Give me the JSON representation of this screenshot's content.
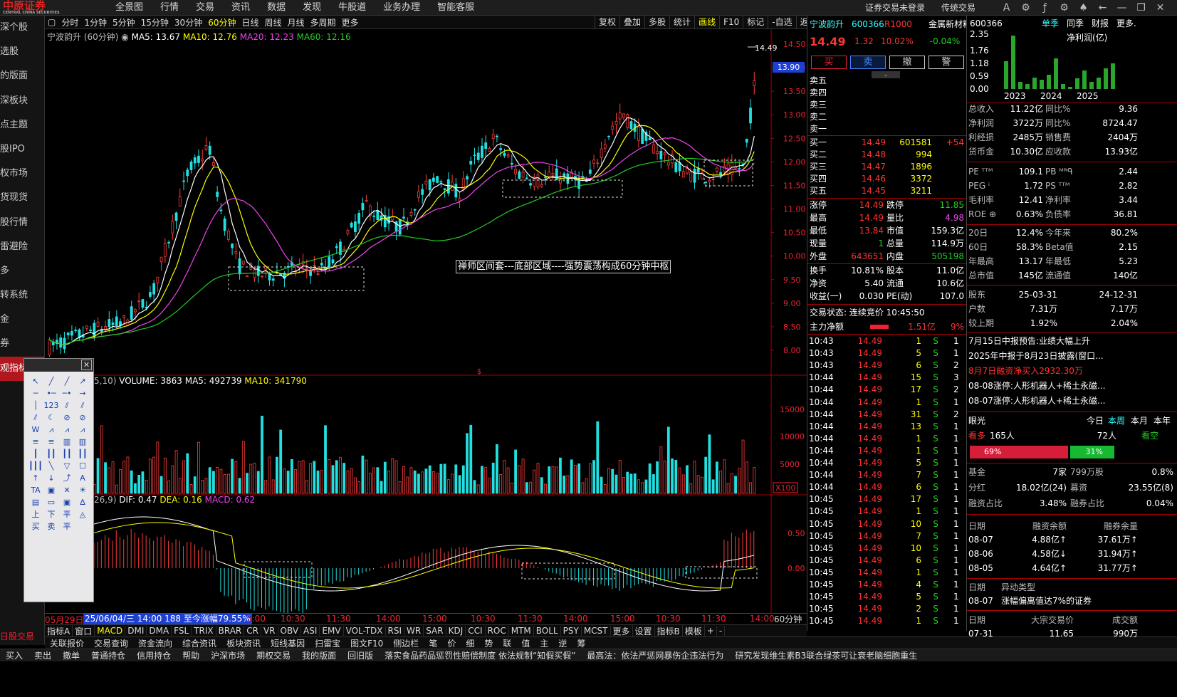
{
  "app": {
    "logo": "中原证券",
    "logo_en": "CENTRAL CHINA SECURITIES"
  },
  "menu": [
    "全景图",
    "行情",
    "交易",
    "资讯",
    "数据",
    "发现",
    "牛股道",
    "业务办理",
    "智能客服"
  ],
  "top_right": {
    "trade_status": "证券交易未登录",
    "traditional": "传统交易"
  },
  "left_nav": [
    "深个股",
    "选股",
    "的版面",
    "深板块",
    "点主题",
    "股IPO",
    "权市场",
    "货现货",
    "股行情",
    "雷避险",
    "多",
    "转系统",
    "金",
    "券",
    "观指标"
  ],
  "periods": [
    "分时",
    "1分钟",
    "5分钟",
    "15分钟",
    "30分钟",
    "60分钟",
    "日线",
    "周线",
    "月线",
    "多周期",
    "更多"
  ],
  "chart_buttons": [
    "复权",
    "叠加",
    "多股",
    "统计",
    "画线",
    "F10",
    "标记",
    "-自选",
    "返回"
  ],
  "ma_legend": {
    "name": "宁波韵升 (60分钟)",
    "ma5": "MA5: 13.67",
    "ma10": "MA10: 12.76",
    "ma20": "MA20: 12.23",
    "ma60": "MA60: 12.16"
  },
  "vol_legend": {
    "prefix": "5,10)",
    "vol": "VOLUME: 3863",
    "ma5": "MA5: 492739",
    "ma10": "MA10: 341790"
  },
  "macd_legend": {
    "prefix": "26,9)",
    "dif": "DIF: 0.47",
    "dea": "DEA: 0.16",
    "macd": "MACD: 0.62"
  },
  "annotation": "禅师区间套---底部区域----强势震荡构成60分钟中枢",
  "price_axis": [
    "14.50",
    "14.00",
    "13.50",
    "13.00",
    "12.50",
    "12.00",
    "11.50",
    "11.00",
    "10.50",
    "10.00",
    "9.50",
    "9.00",
    "8.50",
    "8.00"
  ],
  "current_price_tag": "13.90",
  "high_label": "14.49",
  "vol_axis": [
    "15000",
    "10000",
    "5000",
    "X100"
  ],
  "macd_axis": [
    "0.50",
    "0.00"
  ],
  "time_bar": {
    "start": "05月29日",
    "cursor": "25/06/04/三 14:00 188 至今涨幅79.55%",
    "ticks": [
      "5:00",
      "10:30",
      "11:30",
      "14:00",
      "15:00",
      "10:30",
      "11:30",
      "14:00",
      "15:00",
      "10:30",
      "11:30",
      "14:00"
    ],
    "period": "60分钟"
  },
  "indicators": [
    "指标A",
    "窗口",
    "MACD",
    "DMI",
    "DMA",
    "FSL",
    "TRIX",
    "BRAR",
    "CR",
    "VR",
    "OBV",
    "ASI",
    "EMV",
    "VOL-TDX",
    "RSI",
    "WR",
    "SAR",
    "KDJ",
    "CCI",
    "ROC",
    "MTM",
    "BOLL",
    "PSY",
    "MCST",
    "更多",
    "设置",
    "指标B",
    "模板",
    "+",
    "-"
  ],
  "bottom": [
    "关联报价",
    "交易查询",
    "资金流向",
    "综合资讯",
    "板块资讯",
    "短线基因",
    "扫雷宝",
    "图文F10",
    "侧边栏"
  ],
  "bottom_right_tabs": [
    "笔",
    "价",
    "细",
    "势",
    "联",
    "值",
    "主",
    "逆",
    "筹"
  ],
  "status": [
    "买入",
    "卖出",
    "撤单",
    "普通持仓",
    "信用持仓",
    "帮助",
    "沪深市场",
    "期权交易",
    "我的版面",
    "回旧版",
    "落实食品药品惩罚性赔偿制度 依法规制“知假买假”",
    "最高法：依法严惩网暴伤企违法行为",
    "研究发现维生素B3联合绿茶可让衰老脑细胞重生"
  ],
  "left_bottom_label": "日股交易",
  "quote": {
    "name": "宁波韵升",
    "code": "600366",
    "badge": "R1000",
    "sector": "金属新材料",
    "sector_chg": "-0.04%",
    "price": "14.49",
    "chg": "1.32",
    "pct": "10.02%",
    "buttons": [
      "买",
      "卖",
      "撤",
      "警"
    ],
    "sell": [
      {
        "l": "卖五"
      },
      {
        "l": "卖四"
      },
      {
        "l": "卖三"
      },
      {
        "l": "卖二"
      },
      {
        "l": "卖一"
      }
    ],
    "buy": [
      {
        "l": "买一",
        "p": "14.49",
        "v": "601581",
        "x": "+54"
      },
      {
        "l": "买二",
        "p": "14.48",
        "v": "994",
        "x": ""
      },
      {
        "l": "买三",
        "p": "14.47",
        "v": "1896",
        "x": ""
      },
      {
        "l": "买四",
        "p": "14.46",
        "v": "3372",
        "x": ""
      },
      {
        "l": "买五",
        "p": "14.45",
        "v": "3211",
        "x": ""
      }
    ],
    "stats": [
      [
        "涨停",
        "14.49",
        "跌停",
        "11.85"
      ],
      [
        "最高",
        "14.49",
        "量比",
        "4.98"
      ],
      [
        "最低",
        "13.84",
        "市值",
        "159.3亿"
      ],
      [
        "现量",
        "1",
        "总量",
        "114.9万"
      ],
      [
        "外盘",
        "643651",
        "内盘",
        "505198"
      ]
    ],
    "stats2": [
      [
        "换手",
        "10.81%",
        "股本",
        "11.0亿"
      ],
      [
        "净资",
        "5.40",
        "流通",
        "10.6亿"
      ],
      [
        "收益(一)",
        "0.030",
        "PE(动)",
        "107.0"
      ]
    ],
    "state": "交易状态: 连续竞价 10:45:50",
    "main_net": "主力净额",
    "main_net_val": "1.51亿",
    "main_net_pct": "9%",
    "ticks": [
      [
        "10:43",
        "14.49",
        "1",
        "S"
      ],
      [
        "10:43",
        "14.49",
        "5",
        "S"
      ],
      [
        "10:43",
        "14.49",
        "6",
        "S"
      ],
      [
        "10:44",
        "14.49",
        "15",
        "S"
      ],
      [
        "10:44",
        "14.49",
        "17",
        "S"
      ],
      [
        "10:44",
        "14.49",
        "1",
        "S"
      ],
      [
        "10:44",
        "14.49",
        "31",
        "S"
      ],
      [
        "10:44",
        "14.49",
        "13",
        "S"
      ],
      [
        "10:44",
        "14.49",
        "1",
        "S"
      ],
      [
        "10:44",
        "14.49",
        "1",
        "S"
      ],
      [
        "10:44",
        "14.49",
        "5",
        "S"
      ],
      [
        "10:44",
        "14.49",
        "7",
        "S"
      ],
      [
        "10:44",
        "14.49",
        "6",
        "S"
      ],
      [
        "10:45",
        "14.49",
        "17",
        "S"
      ],
      [
        "10:45",
        "14.49",
        "1",
        "S"
      ],
      [
        "10:45",
        "14.49",
        "10",
        "S"
      ],
      [
        "10:45",
        "14.49",
        "7",
        "S"
      ],
      [
        "10:45",
        "14.49",
        "10",
        "S"
      ],
      [
        "10:45",
        "14.49",
        "6",
        "S"
      ],
      [
        "10:45",
        "14.49",
        "1",
        "S"
      ],
      [
        "10:45",
        "14.49",
        "4",
        "S"
      ],
      [
        "10:45",
        "14.49",
        "5",
        "S"
      ],
      [
        "10:45",
        "14.49",
        "2",
        "S"
      ],
      [
        "10:45",
        "14.49",
        "1",
        "S"
      ]
    ],
    "tick_tail": [
      "1",
      "1",
      "2",
      "3",
      "2",
      "1",
      "2",
      "1",
      "1",
      "1",
      "1",
      "1",
      "1",
      "1",
      "1",
      "1",
      "1",
      "1",
      "1",
      "1",
      "1",
      "1",
      "1",
      "1"
    ]
  },
  "fund": {
    "code": "600366",
    "tabs": [
      "单季",
      "同季",
      "财报",
      "更多."
    ],
    "chart_title": "净利润(亿)",
    "y_axis": [
      "2.35",
      "1.76",
      "1.18",
      "0.59",
      "0.00"
    ],
    "years": [
      "2023",
      "2024",
      "2025"
    ],
    "bars": [
      1.2,
      2.3,
      0.3,
      0.2,
      0.5,
      0.4,
      0.6,
      1.3,
      0.2,
      0.1,
      0.45,
      0.8,
      0.3,
      0.5,
      0.9,
      1.1
    ],
    "rows1": [
      [
        "总收入",
        "11.22亿",
        "同比%",
        "9.36"
      ],
      [
        "净利润",
        "3722万",
        "同比%",
        "8724.47"
      ],
      [
        "利经损",
        "2485万",
        "销售费",
        "2404万"
      ],
      [
        "货币金",
        "10.30亿",
        "应收款",
        "13.93亿"
      ]
    ],
    "rows2": [
      [
        "PE ᵀᵀᴹ",
        "109.1",
        "PB ᴹᴿᑫ",
        "2.44"
      ],
      [
        "PEG ⁱ",
        "1.72",
        "PS ᵀᵀᴹ",
        "2.82"
      ],
      [
        "毛利率",
        "12.41",
        "净利率",
        "3.44"
      ],
      [
        "ROE ⊕",
        "0.63%",
        "负债率",
        "36.81"
      ]
    ],
    "rows3": [
      [
        "20日",
        "12.4%",
        "今年来",
        "80.2%"
      ],
      [
        "60日",
        "58.3%",
        "Beta值",
        "2.15"
      ],
      [
        "年最高",
        "13.17",
        "年最低",
        "5.23"
      ],
      [
        "总市值",
        "145亿",
        "流通值",
        "140亿"
      ]
    ],
    "rows4": [
      [
        "股东",
        "25-03-31",
        "24-12-31"
      ],
      [
        "户数",
        "7.31万",
        "7.17万"
      ],
      [
        "较上期",
        "1.92%",
        "2.04%"
      ]
    ],
    "news": [
      "7月15日中报预告:业绩大幅上升",
      "2025年中报于8月23日披露(窗口...",
      "8月7日融资净买入2932.30万",
      "08-08涨停:人形机器人+稀土永磁...",
      "08-07涨停:人形机器人+稀土永磁..."
    ],
    "sentiment": {
      "title": "眼光",
      "tabs": [
        "今日",
        "本周",
        "本月",
        "本年"
      ],
      "bull": "看多",
      "bull_n": "165人",
      "bear_n": "72人",
      "bear": "看空",
      "bull_pct": "69%",
      "bear_pct": "31%"
    },
    "rows5": [
      [
        "基金",
        "7家",
        "799万股",
        "0.8%"
      ],
      [
        "分红",
        "18.02亿(24)",
        "募资",
        "23.55亿(8)"
      ],
      [
        "融资占比",
        "3.48%",
        "融券占比",
        "0.04%"
      ]
    ],
    "margin_hdr": [
      "日期",
      "融资余额",
      "融券余量"
    ],
    "margin": [
      [
        "08-07",
        "4.88亿↑",
        "37.61万↑"
      ],
      [
        "08-06",
        "4.58亿↓",
        "31.94万↑"
      ],
      [
        "08-05",
        "4.64亿↑",
        "31.77万↑"
      ]
    ],
    "abnormal_hdr": [
      "日期",
      "异动类型"
    ],
    "abnormal": [
      "08-07",
      "涨幅偏离值达7%的证券"
    ],
    "block_hdr": [
      "日期",
      "大宗交易价",
      "成交额"
    ],
    "block": [
      "07-31",
      "11.65",
      "990万"
    ]
  }
}
